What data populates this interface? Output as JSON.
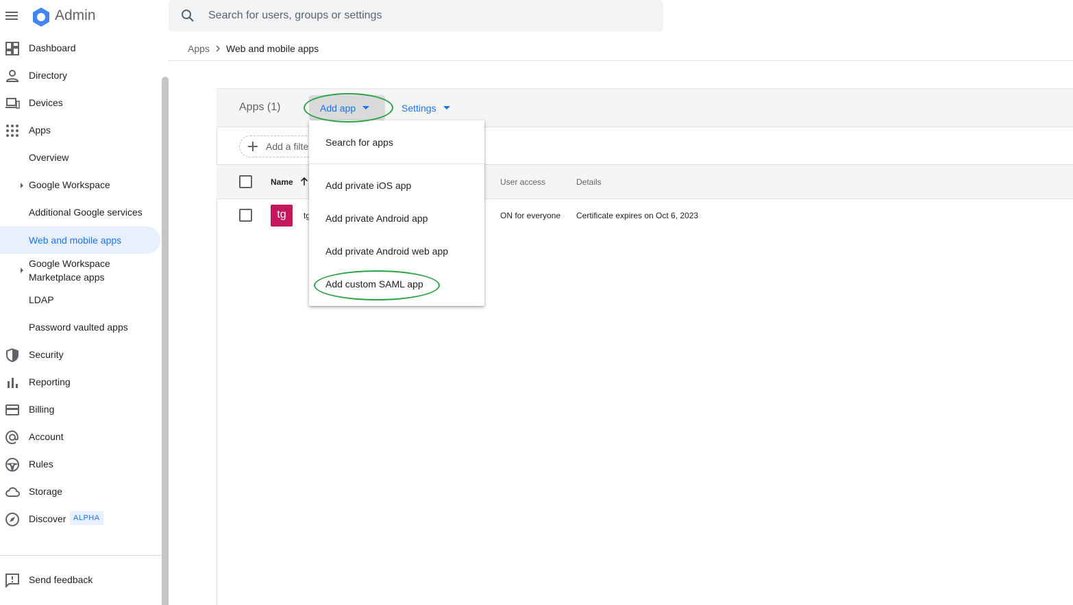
{
  "header": {
    "app_title": "Admin",
    "search_placeholder": "Search for users, groups or settings"
  },
  "breadcrumb": {
    "parent": "Apps",
    "current": "Web and mobile apps"
  },
  "sidebar": {
    "items": [
      {
        "label": "Dashboard",
        "icon": "dashboard-icon"
      },
      {
        "label": "Directory",
        "icon": "person-icon"
      },
      {
        "label": "Devices",
        "icon": "devices-icon"
      },
      {
        "label": "Apps",
        "icon": "apps-grid-icon"
      },
      {
        "label": "Security",
        "icon": "shield-icon"
      },
      {
        "label": "Reporting",
        "icon": "bar-chart-icon"
      },
      {
        "label": "Billing",
        "icon": "credit-card-icon"
      },
      {
        "label": "Account",
        "icon": "at-sign-icon"
      },
      {
        "label": "Rules",
        "icon": "steering-wheel-icon"
      },
      {
        "label": "Storage",
        "icon": "cloud-icon"
      },
      {
        "label": "Discover",
        "icon": "compass-icon",
        "badge": "ALPHA"
      }
    ],
    "apps_children": [
      {
        "label": "Overview"
      },
      {
        "label": "Google Workspace"
      },
      {
        "label": "Additional Google services"
      },
      {
        "label": "Web and mobile apps",
        "active": true
      },
      {
        "label_line1": "Google Workspace",
        "label_line2": "Marketplace apps"
      },
      {
        "label": "LDAP"
      },
      {
        "label": "Password vaulted apps"
      }
    ],
    "feedback": "Send feedback"
  },
  "toolbar": {
    "apps_count": "Apps (1)",
    "add_app": "Add app",
    "settings": "Settings",
    "add_filter": "Add a filter"
  },
  "table": {
    "columns": {
      "name": "Name",
      "user_access": "User access",
      "details": "Details"
    },
    "rows": [
      {
        "avatar": "tg",
        "name": "tg",
        "user_access": "ON for everyone",
        "details": "Certificate expires on Oct 6, 2023"
      }
    ]
  },
  "add_app_menu": {
    "items": [
      "Search for apps",
      "Add private iOS app",
      "Add private Android app",
      "Add private Android web app",
      "Add custom SAML app"
    ]
  },
  "colors": {
    "accent": "#1a73e8",
    "highlight_ellipse": "#2aa344",
    "avatar": "#c2185b"
  }
}
